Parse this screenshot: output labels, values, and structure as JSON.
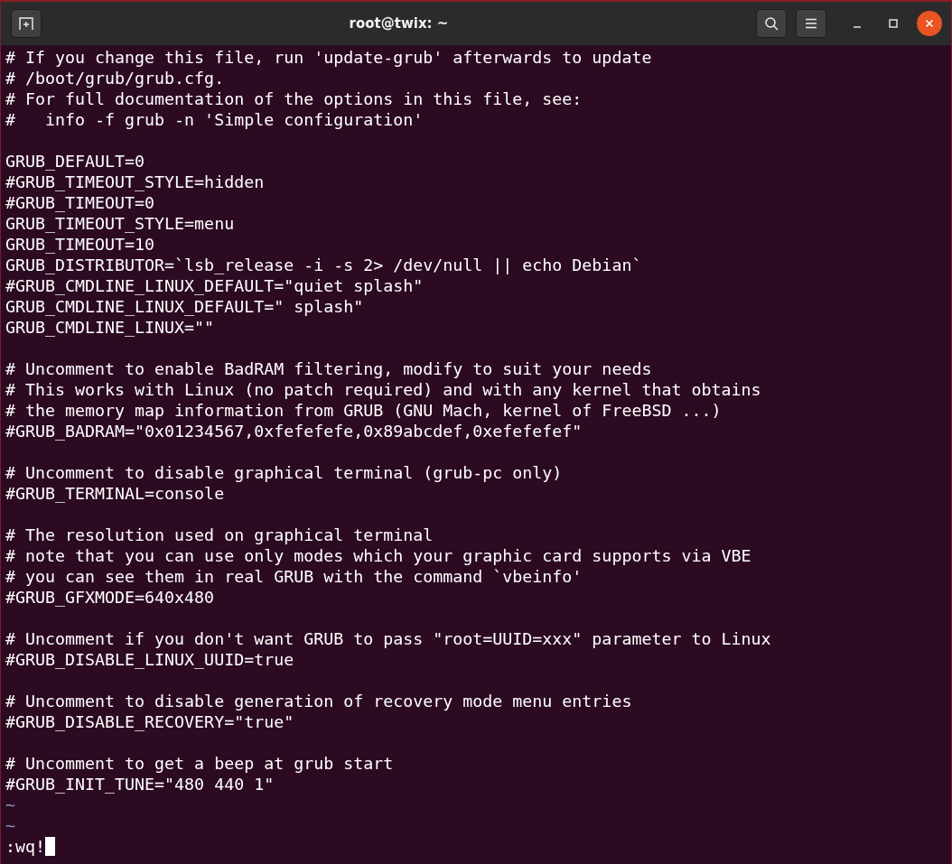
{
  "window": {
    "title": "root@twix: ~"
  },
  "lines": [
    {
      "kind": "text",
      "text": "# If you change this file, run 'update-grub' afterwards to update"
    },
    {
      "kind": "text",
      "text": "# /boot/grub/grub.cfg."
    },
    {
      "kind": "text",
      "text": "# For full documentation of the options in this file, see:"
    },
    {
      "kind": "text",
      "text": "#   info -f grub -n 'Simple configuration'"
    },
    {
      "kind": "blank"
    },
    {
      "kind": "text",
      "text": "GRUB_DEFAULT=0"
    },
    {
      "kind": "text",
      "text": "#GRUB_TIMEOUT_STYLE=hidden"
    },
    {
      "kind": "text",
      "text": "#GRUB_TIMEOUT=0"
    },
    {
      "kind": "text",
      "text": "GRUB_TIMEOUT_STYLE=menu"
    },
    {
      "kind": "text",
      "text": "GRUB_TIMEOUT=10"
    },
    {
      "kind": "text",
      "text": "GRUB_DISTRIBUTOR=`lsb_release -i -s 2> /dev/null || echo Debian`"
    },
    {
      "kind": "text",
      "text": "#GRUB_CMDLINE_LINUX_DEFAULT=\"quiet splash\""
    },
    {
      "kind": "text",
      "text": "GRUB_CMDLINE_LINUX_DEFAULT=\" splash\""
    },
    {
      "kind": "text",
      "text": "GRUB_CMDLINE_LINUX=\"\""
    },
    {
      "kind": "blank"
    },
    {
      "kind": "text",
      "text": "# Uncomment to enable BadRAM filtering, modify to suit your needs"
    },
    {
      "kind": "text",
      "text": "# This works with Linux (no patch required) and with any kernel that obtains"
    },
    {
      "kind": "text",
      "text": "# the memory map information from GRUB (GNU Mach, kernel of FreeBSD ...)"
    },
    {
      "kind": "text",
      "text": "#GRUB_BADRAM=\"0x01234567,0xfefefefe,0x89abcdef,0xefefefef\""
    },
    {
      "kind": "blank"
    },
    {
      "kind": "text",
      "text": "# Uncomment to disable graphical terminal (grub-pc only)"
    },
    {
      "kind": "text",
      "text": "#GRUB_TERMINAL=console"
    },
    {
      "kind": "blank"
    },
    {
      "kind": "text",
      "text": "# The resolution used on graphical terminal"
    },
    {
      "kind": "text",
      "text": "# note that you can use only modes which your graphic card supports via VBE"
    },
    {
      "kind": "text",
      "text": "# you can see them in real GRUB with the command `vbeinfo'"
    },
    {
      "kind": "text",
      "text": "#GRUB_GFXMODE=640x480"
    },
    {
      "kind": "blank"
    },
    {
      "kind": "text",
      "text": "# Uncomment if you don't want GRUB to pass \"root=UUID=xxx\" parameter to Linux"
    },
    {
      "kind": "text",
      "text": "#GRUB_DISABLE_LINUX_UUID=true"
    },
    {
      "kind": "blank"
    },
    {
      "kind": "text",
      "text": "# Uncomment to disable generation of recovery mode menu entries"
    },
    {
      "kind": "text",
      "text": "#GRUB_DISABLE_RECOVERY=\"true\""
    },
    {
      "kind": "blank"
    },
    {
      "kind": "text",
      "text": "# Uncomment to get a beep at grub start"
    },
    {
      "kind": "text",
      "text": "#GRUB_INIT_TUNE=\"480 440 1\""
    },
    {
      "kind": "tilde",
      "text": "~"
    },
    {
      "kind": "tilde",
      "text": "~"
    }
  ],
  "command_line": {
    "text": ":wq!"
  }
}
